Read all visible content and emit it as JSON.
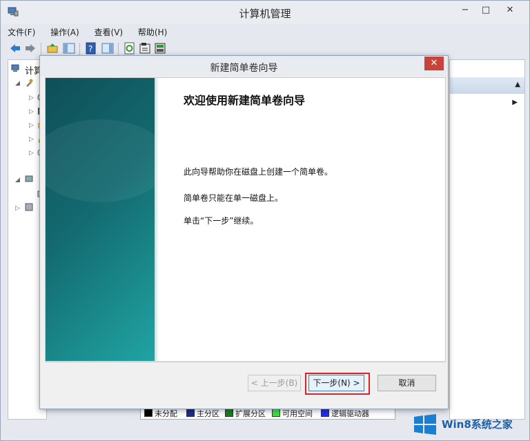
{
  "window": {
    "title": "计算机管理",
    "minimize": "−",
    "maximize": "□",
    "close": "✕"
  },
  "menu": [
    {
      "label": "文件(F)"
    },
    {
      "label": "操作(A)"
    },
    {
      "label": "查看(V)"
    },
    {
      "label": "帮助(H)"
    }
  ],
  "tree": {
    "root_label": "计算"
  },
  "legend": [
    {
      "label": "未分配",
      "color": "#000000"
    },
    {
      "label": "主分区",
      "color": "#1f2d8a"
    },
    {
      "label": "扩展分区",
      "color": "#1b7d23"
    },
    {
      "label": "可用空间",
      "color": "#3fe03f"
    },
    {
      "label": "逻辑驱动器",
      "color": "#1f2df0"
    }
  ],
  "dialog": {
    "title": "新建简单卷向导",
    "close": "✕",
    "heading": "欢迎使用新建简单卷向导",
    "paragraphs": [
      "此向导帮助你在磁盘上创建一个简单卷。",
      "简单卷只能在单一磁盘上。",
      "单击“下一步”继续。"
    ],
    "back_button": "< 上一步(B)",
    "next_button": "下一步(N) >",
    "cancel_button": "取消"
  },
  "watermark": {
    "text": "Win8系统之家"
  },
  "colors": {
    "highlight": "#d9232b",
    "banner": "#136a70",
    "close_red": "#c7443a"
  }
}
